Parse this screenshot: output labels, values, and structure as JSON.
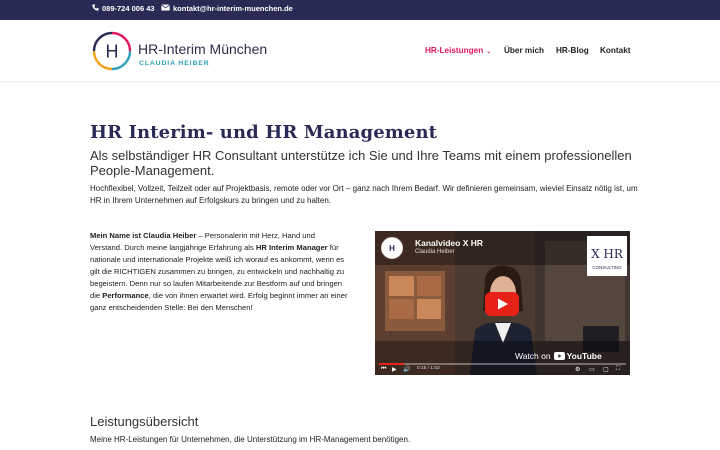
{
  "topbar": {
    "phone": "089-724 006 43",
    "email": "kontakt@hr-interim-muenchen.de",
    "phone_icon": "phone-icon",
    "email_icon": "envelope-icon"
  },
  "brand": {
    "logo_letter": "H",
    "name": "HR-Interim München",
    "subtitle": "CLAUDIA HEIBER"
  },
  "nav": {
    "items": [
      {
        "label": "HR-Leistungen",
        "active": true,
        "has_dropdown": true
      },
      {
        "label": "Über mich"
      },
      {
        "label": "HR-Blog"
      },
      {
        "label": "Kontakt"
      }
    ]
  },
  "main": {
    "title": "HR Interim- und HR Management",
    "lead": "Als selbständiger HR Consultant unterstütze ich Sie und Ihre Teams mit einem professionellen People-Management.",
    "paragraph": "Hochflexibel, Vollzeit, Teilzeit oder auf Projektbasis, remote oder vor Ort – ganz nach Ihrem Bedarf. Wir definieren gemeinsam, wieviel Einsatz nötig ist, um HR in Ihrem Unternehmen auf Erfolgskurs zu bringen und zu halten."
  },
  "intro": {
    "b1": "Mein Name ist Claudia Heiber",
    "t1": " – Personalerin mit Herz, Hand und Verstand. Durch meine langjährige Erfahrung als ",
    "b2": "HR Interim Manager",
    "t2": " für nationale und internationale Projekte weiß ich worauf es ankommt, wenn es gilt die RICHTIGEN zusammen zu bringen, zu entwickeln und nachhaltig zu begeistern. Denn nur so laufen Mitarbeitende zur Bestform auf und bringen die ",
    "b3": "Performance",
    "t3": ", die von ihnen erwartet wird. Erfolg beginnt immer an einer ganz entscheidenden Stelle: Bei den Menschen!"
  },
  "video": {
    "title": "Kanalvideo X HR",
    "channel": "Claudia Heiber",
    "watch_on": "Watch on",
    "youtube": "YouTube",
    "time": "0:15 / 1:53",
    "progress": 0.1,
    "logo_text": "X HR",
    "logo_caption": "CONSULTING"
  },
  "services": {
    "title": "Leistungsübersicht",
    "subtitle": "Meine HR-Leistungen für Unternehmen, die Unterstützung im HR-Management benötigen."
  },
  "colors": {
    "topbar": "#2a2b55",
    "accent": "#e2175b",
    "title": "#2a2b55",
    "brand_sub": "#2fa0b8"
  }
}
